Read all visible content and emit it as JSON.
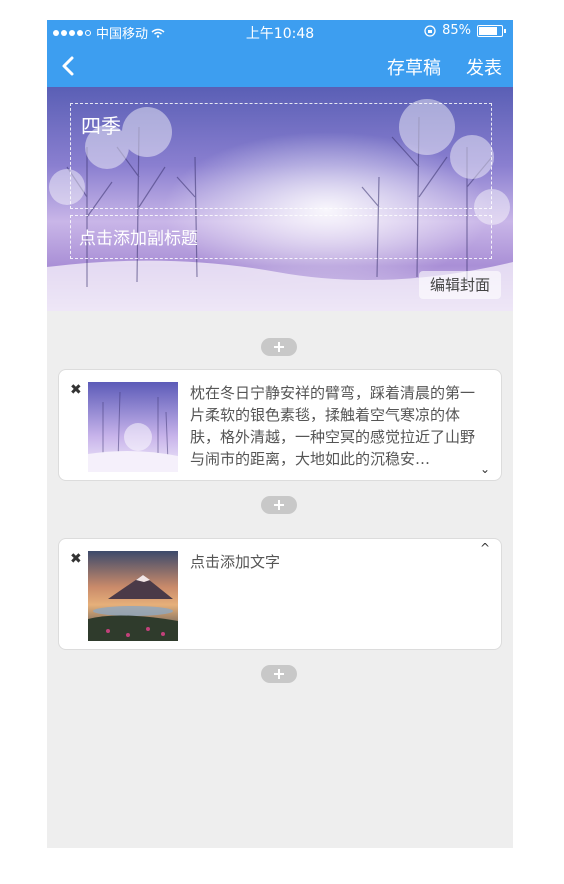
{
  "status": {
    "carrier": "中国移动",
    "time": "上午10:48",
    "battery": "85%"
  },
  "nav": {
    "draft_label": "存草稿",
    "publish_label": "发表"
  },
  "cover": {
    "title": "四季",
    "subtitle_placeholder": "点击添加副标题",
    "edit_label": "编辑封面"
  },
  "cards": [
    {
      "text": "枕在冬日宁静安祥的臂弯，踩着清晨的第一片柔软的银色素毯，揉触着空气寒凉的体肤，格外清越，一种空冥的感觉拉近了山野与闹市的距离，大地如此的沉稳安…",
      "toggle": "chevron-down"
    },
    {
      "text": "点击添加文字",
      "toggle": "chevron-up"
    }
  ],
  "colors": {
    "accent": "#3d9ef0",
    "background": "#eeeeee"
  }
}
